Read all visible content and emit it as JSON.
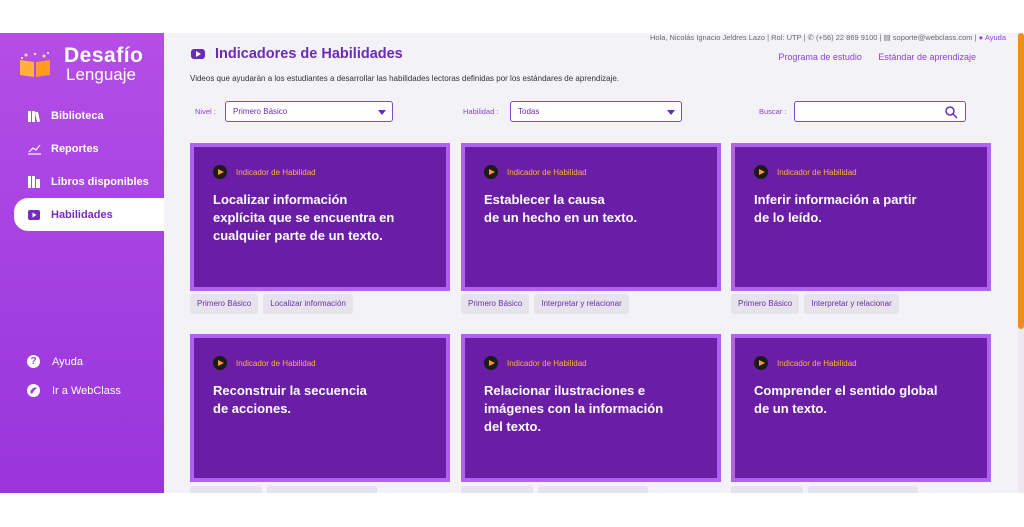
{
  "logo": {
    "title": "Desafío",
    "subtitle": "Lenguaje"
  },
  "sidebar": {
    "items": [
      {
        "label": "Biblioteca",
        "icon": "library-icon"
      },
      {
        "label": "Reportes",
        "icon": "chart-icon"
      },
      {
        "label": "Libros disponibles",
        "icon": "books-icon"
      },
      {
        "label": "Habilidades",
        "icon": "video-icon",
        "active": true
      }
    ],
    "bottom": [
      {
        "label": "Ayuda",
        "icon": "help-icon"
      },
      {
        "label": "Ir a WebClass",
        "icon": "webclass-icon"
      }
    ]
  },
  "topbar": {
    "greeting": "Hola, Nicolás Ignacio Jeldres Lazo | Rol: UTP | ",
    "phone": "(+56) 22 869 9100",
    "email": "soporte@webclass.com",
    "help": "Ayuda"
  },
  "header": {
    "title": "Indicadores de Habilidades",
    "subtitle": "Videos que ayudarán a los estudiantes a desarrollar las habilidades lectoras definidas por los estándares de aprendizaje.",
    "links": [
      "Programa de estudio",
      "Estándar de aprendizaje"
    ]
  },
  "filters": {
    "level_label": "Nivel :",
    "level_value": "Primero Básico",
    "skill_label": "Habilidad :",
    "skill_value": "Todas",
    "search_label": "Buscar :",
    "search_value": ""
  },
  "cards": [
    {
      "tag": "Indicador de Habilidad",
      "text": "Localizar información\nexplícita que se encuentra en\ncualquier parte de un texto.",
      "chips": [
        "Primero Básico",
        "Localizar información"
      ]
    },
    {
      "tag": "Indicador de Habilidad",
      "text": "Establecer la causa\nde un hecho en un texto.",
      "chips": [
        "Primero Básico",
        "Interpretar y relacionar"
      ]
    },
    {
      "tag": "Indicador de Habilidad",
      "text": "Inferir información a partir\nde lo leído.",
      "chips": [
        "Primero Básico",
        "Interpretar y relacionar"
      ]
    },
    {
      "tag": "Indicador de Habilidad",
      "text": "Reconstruir la secuencia\nde acciones.",
      "chips": [
        "",
        ""
      ]
    },
    {
      "tag": "Indicador de Habilidad",
      "text": "Relacionar ilustraciones e\nimágenes con la información\ndel texto.",
      "chips": [
        "",
        ""
      ]
    },
    {
      "tag": "Indicador de Habilidad",
      "text": "Comprender el sentido global\nde un texto.",
      "chips": [
        "",
        ""
      ]
    }
  ],
  "colors": {
    "sidebar": "#a23fe0",
    "card": "#6a1ea6",
    "card_border": "#b262f0",
    "accent": "#ffb13b",
    "scroll_thumb": "#f28c1f"
  }
}
